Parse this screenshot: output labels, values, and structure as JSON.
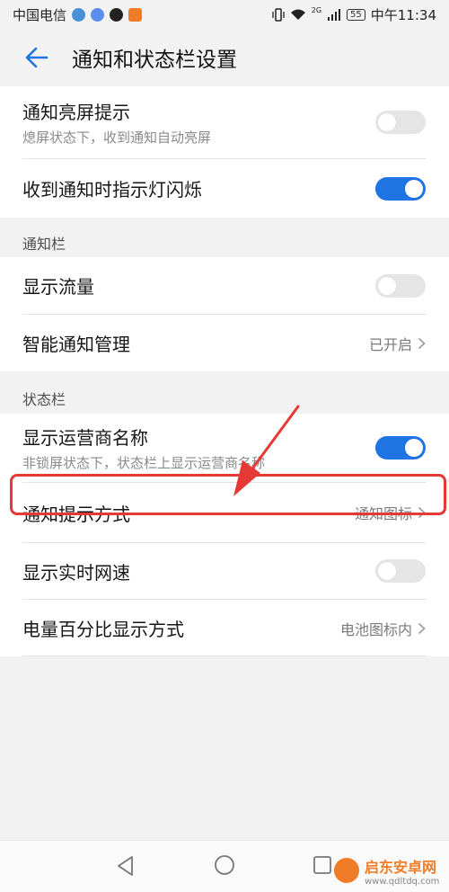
{
  "status_bar": {
    "carrier": "中国电信",
    "network": "2G",
    "battery": "55",
    "time": "中午11:34"
  },
  "header": {
    "title": "通知和状态栏设置"
  },
  "rows": {
    "wake_screen": {
      "label": "通知亮屏提示",
      "sub": "熄屏状态下，收到通知自动亮屏",
      "on": false
    },
    "led_blink": {
      "label": "收到通知时指示灯闪烁",
      "on": true
    },
    "show_traffic": {
      "label": "显示流量",
      "on": false
    },
    "smart_manage": {
      "label": "智能通知管理",
      "value": "已开启"
    },
    "carrier_name": {
      "label": "显示运营商名称",
      "sub": "非锁屏状态下，状态栏上显示运营商名称",
      "on": true
    },
    "notif_style": {
      "label": "通知提示方式",
      "value": "通知图标"
    },
    "net_speed": {
      "label": "显示实时网速",
      "on": false
    },
    "battery_pct": {
      "label": "电量百分比显示方式",
      "value": "电池图标内"
    }
  },
  "sections": {
    "notification_bar": "通知栏",
    "status_bar": "状态栏"
  },
  "watermark": {
    "name": "启东安卓网",
    "url": "www.qdltdq.com"
  },
  "colors": {
    "accent": "#1f74e4",
    "highlight": "#e53935",
    "background": "#f2f2f2"
  }
}
